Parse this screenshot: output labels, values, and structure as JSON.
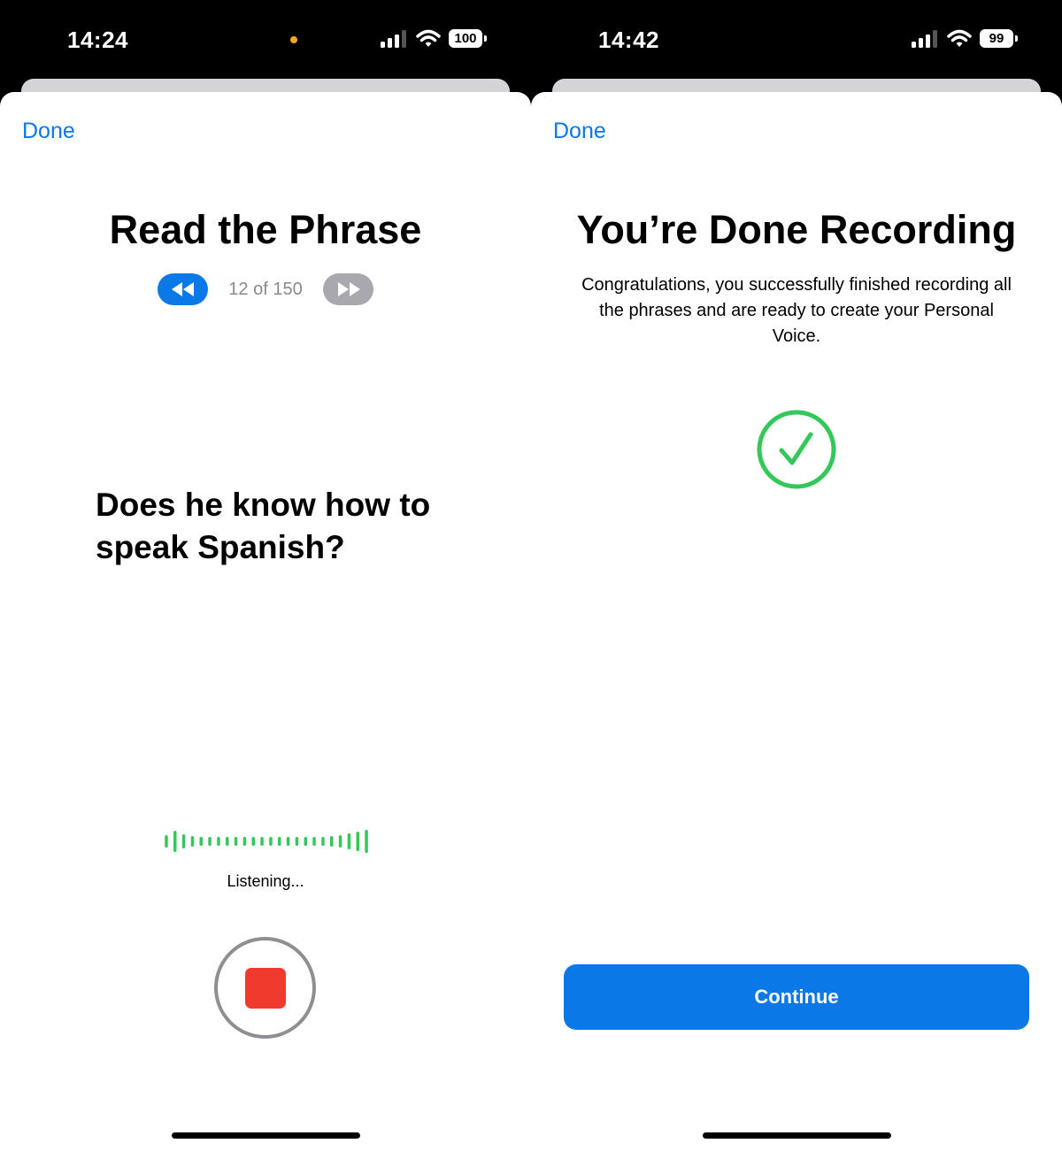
{
  "left": {
    "status": {
      "time": "14:24",
      "battery": "100"
    },
    "done_label": "Done",
    "title": "Read the Phrase",
    "counter": "12 of 150",
    "phrase": "Does he know how to speak Spanish?",
    "listening": "Listening...",
    "colors": {
      "accent": "#0a78e6",
      "record": "#f03a2e",
      "wave": "#34c759",
      "mic_dot": "#f5a623"
    }
  },
  "right": {
    "status": {
      "time": "14:42",
      "battery": "99"
    },
    "done_label": "Done",
    "title": "You’re Done Recording",
    "description": "Congratulations, you successfully finished recording all the phrases and are ready to create your Personal Voice.",
    "continue_label": "Continue",
    "colors": {
      "accent": "#0a78e6",
      "check": "#34c759"
    }
  }
}
